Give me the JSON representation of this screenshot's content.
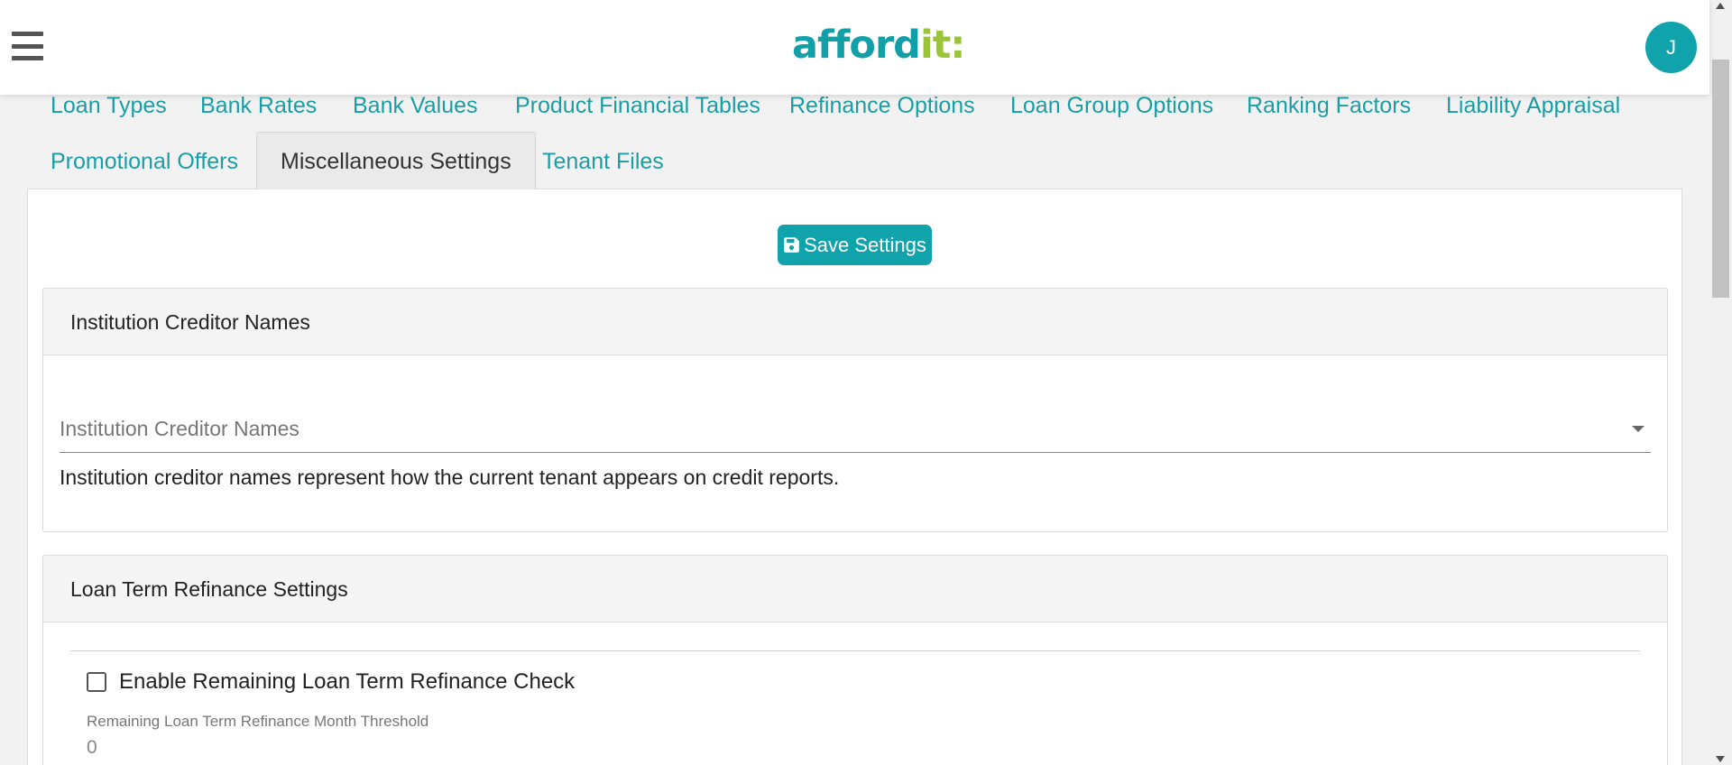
{
  "header": {
    "logo_main": "afford",
    "logo_accent": "it:",
    "avatar_initial": "J"
  },
  "tabs": [
    {
      "label": "Loan Types"
    },
    {
      "label": "Bank Rates"
    },
    {
      "label": "Bank Values"
    },
    {
      "label": "Product Financial Tables"
    },
    {
      "label": "Refinance Options"
    },
    {
      "label": "Loan Group Options"
    },
    {
      "label": "Ranking Factors"
    },
    {
      "label": "Liability Appraisal"
    },
    {
      "label": "Promotional Offers"
    },
    {
      "label": "Miscellaneous Settings"
    },
    {
      "label": "Tenant Files"
    }
  ],
  "active_tab": "Miscellaneous Settings",
  "toolbar": {
    "save_label": "Save Settings",
    "save_icon": "floppy-disk-icon"
  },
  "creditor_card": {
    "title": "Institution Creditor Names",
    "select_placeholder": "Institution Creditor Names",
    "help_text": "Institution creditor names represent how the current tenant appears on credit reports."
  },
  "refinance_card": {
    "title": "Loan Term Refinance Settings",
    "checkbox_label": "Enable Remaining Loan Term Refinance Check",
    "checkbox_checked": false,
    "threshold_label": "Remaining Loan Term Refinance Month Threshold",
    "threshold_value": "0"
  },
  "colors": {
    "brand_teal": "#11a3ab",
    "brand_green": "#9ac53b",
    "tab_link": "#1a9ea6"
  }
}
